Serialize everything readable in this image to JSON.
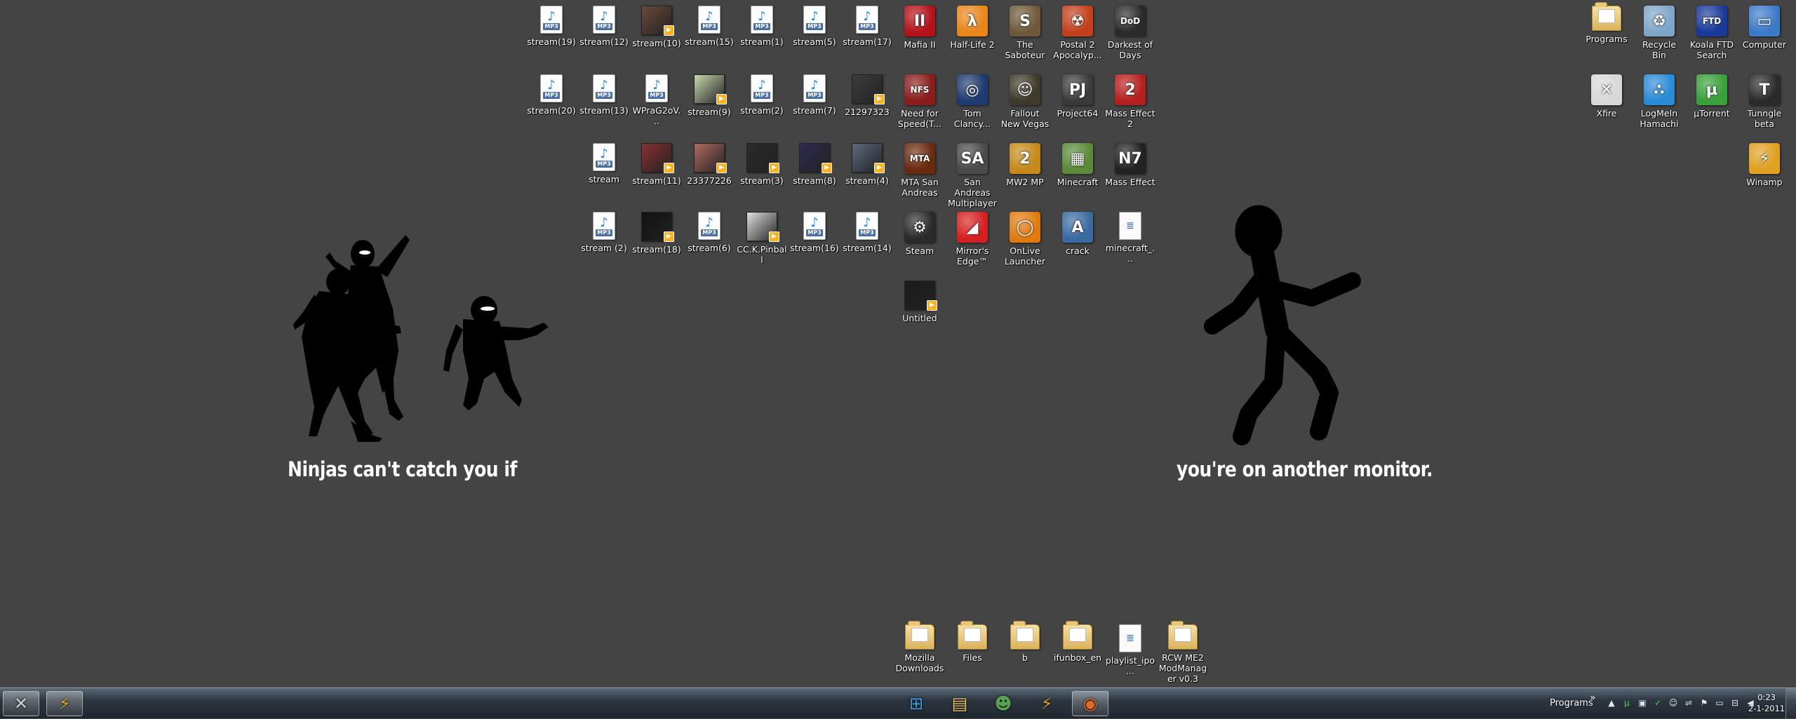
{
  "wallpaper": {
    "caption_left": "Ninjas can't catch you if",
    "caption_right": "you're on another monitor."
  },
  "desktop": {
    "icons": [
      {
        "label": "stream(19)",
        "kind": "mp3",
        "col": 0,
        "row": 0,
        "gx": 0
      },
      {
        "label": "stream(12)",
        "kind": "mp3",
        "col": 1,
        "row": 0,
        "gx": 0
      },
      {
        "label": "stream(10)",
        "kind": "thumb",
        "thumb_color": "#6b4a3a",
        "col": 2,
        "row": 0,
        "gx": 0
      },
      {
        "label": "stream(15)",
        "kind": "mp3",
        "col": 3,
        "row": 0,
        "gx": 0
      },
      {
        "label": "stream(1)",
        "kind": "mp3",
        "col": 4,
        "row": 0,
        "gx": 0
      },
      {
        "label": "stream(5)",
        "kind": "mp3",
        "col": 5,
        "row": 0,
        "gx": 0
      },
      {
        "label": "stream(17)",
        "kind": "mp3",
        "col": 6,
        "row": 0,
        "gx": 0
      },
      {
        "label": "Mafia II",
        "kind": "app",
        "app_color": "#b3121a",
        "glyph": "II",
        "col": 7,
        "row": 0,
        "gx": 0
      },
      {
        "label": "Half-Life 2",
        "kind": "app",
        "app_color": "#e8861b",
        "glyph": "λ",
        "col": 8,
        "row": 0,
        "gx": 0
      },
      {
        "label": "The Saboteur",
        "kind": "app",
        "app_color": "#6e5a3a",
        "glyph": "S",
        "col": 9,
        "row": 0,
        "gx": 0
      },
      {
        "label": "Postal 2 Apocalyp...",
        "kind": "app",
        "app_color": "#c2401c",
        "glyph": "☢",
        "col": 10,
        "row": 0,
        "gx": 0
      },
      {
        "label": "Darkest of Days",
        "kind": "app",
        "app_color": "#2a2a2a",
        "glyph": "DoD",
        "col": 11,
        "row": 0,
        "gx": 0
      },
      {
        "label": "stream(20)",
        "kind": "mp3",
        "col": 0,
        "row": 1,
        "gx": 0
      },
      {
        "label": "stream(13)",
        "kind": "mp3",
        "col": 1,
        "row": 1,
        "gx": 0
      },
      {
        "label": "WPraG2oV...",
        "kind": "mp3",
        "col": 2,
        "row": 1,
        "gx": 0
      },
      {
        "label": "stream(9)",
        "kind": "thumb",
        "thumb_color": "#c9d8b0",
        "col": 3,
        "row": 1,
        "gx": 0
      },
      {
        "label": "stream(2)",
        "kind": "mp3",
        "col": 4,
        "row": 1,
        "gx": 0
      },
      {
        "label": "stream(7)",
        "kind": "mp3",
        "col": 5,
        "row": 1,
        "gx": 0
      },
      {
        "label": "21297323",
        "kind": "thumb",
        "thumb_color": "#3c3c3c",
        "col": 6,
        "row": 1,
        "gx": 0
      },
      {
        "label": "Need for Speed(T...",
        "kind": "app",
        "app_color": "#8a1c1c",
        "glyph": "NFS",
        "col": 7,
        "row": 1,
        "gx": 0
      },
      {
        "label": "Tom Clancy...",
        "kind": "app",
        "app_color": "#1f3a70",
        "glyph": "◎",
        "col": 8,
        "row": 1,
        "gx": 0
      },
      {
        "label": "Fallout New Vegas",
        "kind": "app",
        "app_color": "#3f3a2a",
        "glyph": "☺",
        "col": 9,
        "row": 1,
        "gx": 0
      },
      {
        "label": "Project64",
        "kind": "app",
        "app_color": "#3a3a3a",
        "glyph": "PJ",
        "col": 10,
        "row": 1,
        "gx": 0
      },
      {
        "label": "Mass Effect 2",
        "kind": "app",
        "app_color": "#b51f1f",
        "glyph": "2",
        "col": 11,
        "row": 1,
        "gx": 0
      },
      {
        "label": "stream",
        "kind": "mp3",
        "col": 1,
        "row": 2,
        "gx": 0
      },
      {
        "label": "stream(11)",
        "kind": "thumb",
        "thumb_color": "#8a3030",
        "col": 2,
        "row": 2,
        "gx": 0
      },
      {
        "label": "23377226",
        "kind": "thumb",
        "thumb_color": "#b06a60",
        "col": 3,
        "row": 2,
        "gx": 0
      },
      {
        "label": "stream(3)",
        "kind": "thumb",
        "thumb_color": "#2a2a2a",
        "col": 4,
        "row": 2,
        "gx": 0
      },
      {
        "label": "stream(8)",
        "kind": "thumb",
        "thumb_color": "#2b2b50",
        "col": 5,
        "row": 2,
        "gx": 0
      },
      {
        "label": "stream(4)",
        "kind": "thumb",
        "thumb_color": "#5a6a80",
        "col": 6,
        "row": 2,
        "gx": 0
      },
      {
        "label": "MTA San Andreas",
        "kind": "app",
        "app_color": "#6a2a10",
        "glyph": "MTA",
        "col": 7,
        "row": 2,
        "gx": 0
      },
      {
        "label": "San Andreas Multiplayer",
        "kind": "app",
        "app_color": "#4a4a4a",
        "glyph": "SA",
        "col": 8,
        "row": 2,
        "gx": 0
      },
      {
        "label": "MW2 MP",
        "kind": "app",
        "app_color": "#c58a1a",
        "glyph": "2",
        "col": 9,
        "row": 2,
        "gx": 0
      },
      {
        "label": "Minecraft",
        "kind": "app",
        "app_color": "#5b8a3a",
        "glyph": "▦",
        "col": 10,
        "row": 2,
        "gx": 0
      },
      {
        "label": "Mass Effect",
        "kind": "app",
        "app_color": "#222222",
        "glyph": "N7",
        "col": 11,
        "row": 2,
        "gx": 0
      },
      {
        "label": "stream (2)",
        "kind": "mp3",
        "col": 1,
        "row": 3,
        "gx": 0
      },
      {
        "label": "stream(18)",
        "kind": "thumb",
        "thumb_color": "#111111",
        "col": 2,
        "row": 3,
        "gx": 0
      },
      {
        "label": "stream(6)",
        "kind": "mp3",
        "col": 3,
        "row": 3,
        "gx": 0
      },
      {
        "label": "CC.K.Pinball",
        "kind": "thumb",
        "thumb_color": "#e0e0e0",
        "col": 4,
        "row": 3,
        "gx": 0
      },
      {
        "label": "stream(16)",
        "kind": "mp3",
        "col": 5,
        "row": 3,
        "gx": 0
      },
      {
        "label": "stream(14)",
        "kind": "mp3",
        "col": 6,
        "row": 3,
        "gx": 0
      },
      {
        "label": "Steam",
        "kind": "app",
        "app_color": "#2a2a2a",
        "glyph": "⚙",
        "col": 7,
        "row": 3,
        "gx": 0
      },
      {
        "label": "Mirror's Edge™",
        "kind": "app",
        "app_color": "#d42020",
        "glyph": "◢",
        "col": 8,
        "row": 3,
        "gx": 0
      },
      {
        "label": "OnLive Launcher",
        "kind": "app",
        "app_color": "#e07a10",
        "glyph": "◯",
        "col": 9,
        "row": 3,
        "gx": 0
      },
      {
        "label": "crack",
        "kind": "app",
        "app_color": "#3a6aa0",
        "glyph": "A",
        "col": 10,
        "row": 3,
        "gx": 0
      },
      {
        "label": "minecraft_...",
        "kind": "doc",
        "col": 11,
        "row": 3,
        "gx": 0
      },
      {
        "label": "Untitled",
        "kind": "thumb",
        "thumb_color": "#1a1a1a",
        "col": 7,
        "row": 4,
        "gx": 0
      },
      {
        "label": "Mozilla Downloads",
        "kind": "folder",
        "col": 7,
        "row": 9,
        "gx": 0
      },
      {
        "label": "Files",
        "kind": "folder",
        "col": 8,
        "row": 9,
        "gx": 0
      },
      {
        "label": "b",
        "kind": "folder",
        "col": 9,
        "row": 9,
        "gx": 0
      },
      {
        "label": "ifunbox_en",
        "kind": "folder",
        "col": 10,
        "row": 9,
        "gx": 0
      },
      {
        "label": "playlist_ipo...",
        "kind": "doc",
        "col": 11,
        "row": 9,
        "gx": 0
      },
      {
        "label": "RCW ME2 ModManager v0.3",
        "kind": "folder",
        "col": 12,
        "row": 9,
        "gx": 0
      },
      {
        "label": "Programs",
        "kind": "folder",
        "col": 0,
        "row": 0,
        "gx": 1
      },
      {
        "label": "Recycle Bin",
        "kind": "app",
        "app_color": "#7fa6c8",
        "glyph": "♻",
        "col": 1,
        "row": 0,
        "gx": 1
      },
      {
        "label": "Koala FTD Search",
        "kind": "app",
        "app_color": "#1a3a9a",
        "glyph": "FTD",
        "col": 2,
        "row": 0,
        "gx": 1
      },
      {
        "label": "Computer",
        "kind": "app",
        "app_color": "#3a7ac8",
        "glyph": "▭",
        "col": 3,
        "row": 0,
        "gx": 1
      },
      {
        "label": "Xfire",
        "kind": "app",
        "app_color": "#d8d8d8",
        "glyph": "✕",
        "col": 0,
        "row": 1,
        "gx": 1
      },
      {
        "label": "LogMeIn Hamachi",
        "kind": "app",
        "app_color": "#2a8ad8",
        "glyph": "∴",
        "col": 1,
        "row": 1,
        "gx": 1
      },
      {
        "label": "µTorrent",
        "kind": "app",
        "app_color": "#3aa03a",
        "glyph": "µ",
        "col": 2,
        "row": 1,
        "gx": 1
      },
      {
        "label": "Tunngle beta",
        "kind": "app",
        "app_color": "#2a2a2a",
        "glyph": "T",
        "col": 3,
        "row": 1,
        "gx": 1
      },
      {
        "label": "Winamp",
        "kind": "app",
        "app_color": "#e0a020",
        "glyph": "⚡",
        "col": 3,
        "row": 2,
        "gx": 1
      }
    ]
  },
  "taskbar": {
    "left_buttons": [
      {
        "name": "xfire-taskbar",
        "glyph": "✕",
        "color": "#d0d0d0"
      },
      {
        "name": "winamp-taskbar",
        "glyph": "⚡",
        "color": "#e0a020"
      }
    ],
    "center_buttons": [
      {
        "name": "start-orb",
        "glyph": "⊞",
        "color": "#3a9ad8"
      },
      {
        "name": "explorer-taskbar",
        "glyph": "▤",
        "color": "#e8c060"
      },
      {
        "name": "messenger-taskbar",
        "glyph": "☻",
        "color": "#5aa050"
      },
      {
        "name": "winamp-taskbar-2",
        "glyph": "⚡",
        "color": "#e0a020"
      },
      {
        "name": "firefox-taskbar",
        "glyph": "◉",
        "color": "#e06a20"
      }
    ],
    "tray": {
      "toolbar_label": "Programs",
      "overflow": "»",
      "time": "0:23",
      "date": "2-1-2011"
    }
  }
}
